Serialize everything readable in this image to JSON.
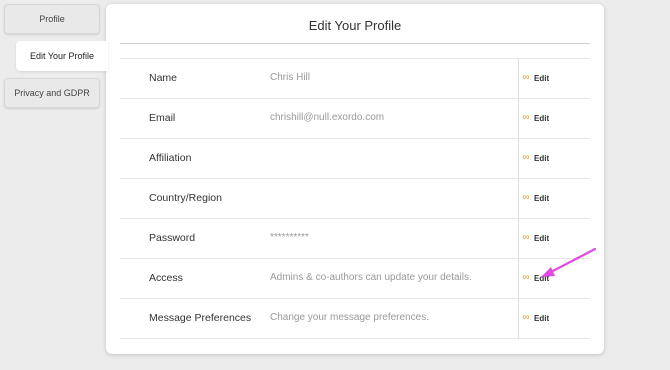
{
  "tabs": [
    {
      "label": "Profile"
    },
    {
      "label": "Edit Your Profile"
    },
    {
      "label": "Privacy and GDPR"
    }
  ],
  "panel": {
    "title": "Edit Your Profile",
    "edit_label": "Edit",
    "rows": [
      {
        "label": "Name",
        "value": "Chris Hill"
      },
      {
        "label": "Email",
        "value": "chrishill@null.exordo.com"
      },
      {
        "label": "Affiliation",
        "value": ""
      },
      {
        "label": "Country/Region",
        "value": ""
      },
      {
        "label": "Password",
        "value": "**********"
      },
      {
        "label": "Access",
        "value": "Admins & co-authors can update your details."
      },
      {
        "label": "Message Preferences",
        "value": "Change your message preferences."
      }
    ]
  },
  "colors": {
    "accent_link": "#e5a13a",
    "annotation_arrow": "#e24ae2"
  },
  "icons": {
    "edit_link": "link-icon"
  }
}
